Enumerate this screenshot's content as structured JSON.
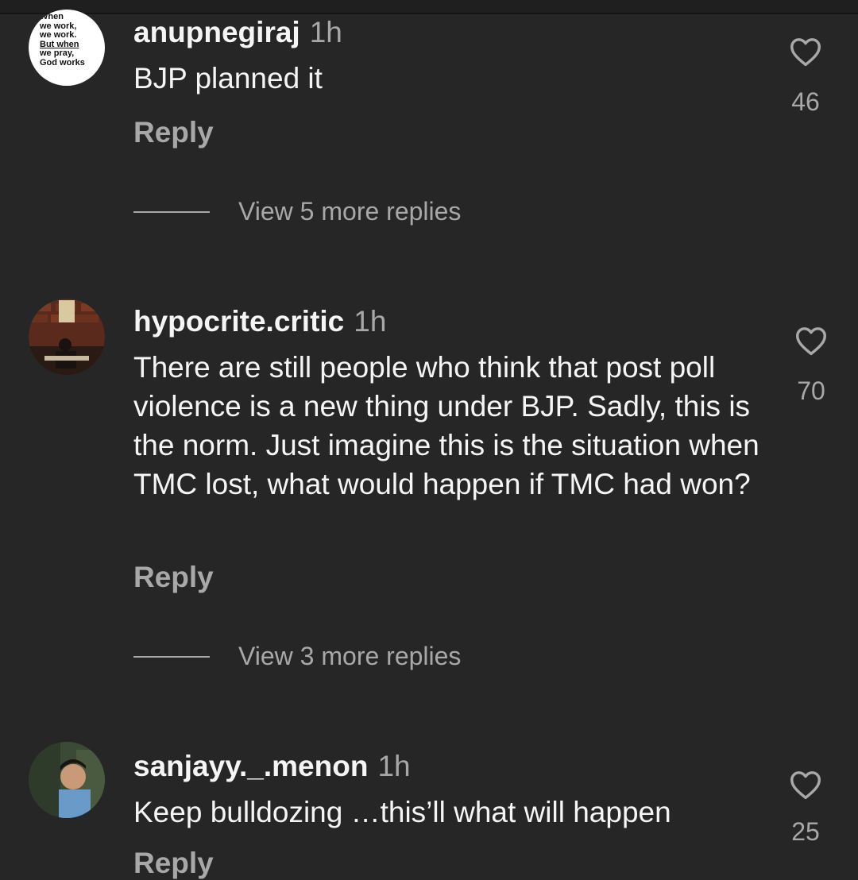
{
  "comments": [
    {
      "username": "anupnegiraj",
      "time": "1h",
      "text": "BJP planned it",
      "reply_label": "Reply",
      "likes": "46",
      "view_replies": "View 5 more replies",
      "avatar_text": [
        "When",
        "we work,",
        "we work.",
        "But when",
        "we pray,",
        "God works"
      ]
    },
    {
      "username": "hypocrite.critic",
      "time": "1h",
      "text": "There are still people who think that post poll violence is a new thing under BJP. Sadly, this is the norm. Just imagine this is the situation when TMC lost, what would happen if TMC had won?",
      "reply_label": "Reply",
      "likes": "70",
      "view_replies": "View 3 more replies"
    },
    {
      "username": "sanjayy._.menon",
      "time": "1h",
      "text": "Keep bulldozing …this’ll what will happen",
      "reply_label": "Reply",
      "likes": "25"
    }
  ],
  "icons": {
    "like": "heart-outline-icon"
  },
  "colors": {
    "background": "#262626",
    "primary_text": "#f5f5f5",
    "secondary_text": "#a8a8a8"
  }
}
